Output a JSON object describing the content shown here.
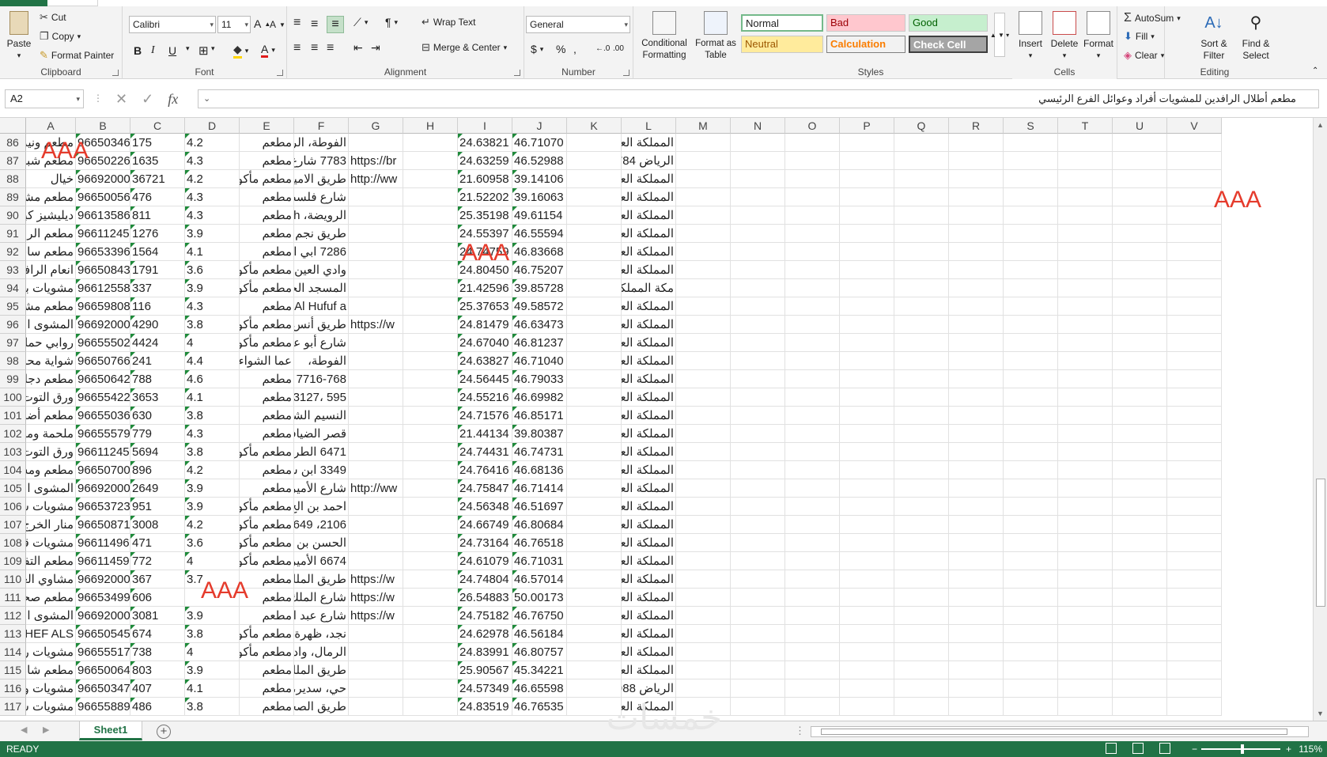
{
  "ribbon": {
    "clipboard": {
      "paste": "Paste",
      "cut": "Cut",
      "copy": "Copy",
      "format_painter": "Format Painter",
      "label": "Clipboard"
    },
    "font": {
      "name": "Calibri",
      "size": "11",
      "label": "Font",
      "bold": "B",
      "italic": "I",
      "underline": "U"
    },
    "alignment": {
      "wrap_text": "Wrap Text",
      "merge_center": "Merge & Center",
      "label": "Alignment"
    },
    "number": {
      "format": "General",
      "currency": "$",
      "percent": "%",
      "comma": ",",
      "label": "Number"
    },
    "styles": {
      "conditional": "Conditional Formatting",
      "format_table": "Format as Table",
      "normal": "Normal",
      "bad": "Bad",
      "good": "Good",
      "neutral": "Neutral",
      "calculation": "Calculation",
      "check_cell": "Check Cell",
      "label": "Styles"
    },
    "cells": {
      "insert": "Insert",
      "delete": "Delete",
      "format": "Format",
      "label": "Cells"
    },
    "editing": {
      "autosum": "AutoSum",
      "fill": "Fill",
      "clear": "Clear",
      "sort_filter": "Sort & Filter",
      "find_select": "Find & Select",
      "label": "Editing"
    }
  },
  "formula_bar": {
    "name_box": "A2",
    "content": "مطعم أطلال الرافدين للمشويات أفراد وعوائل الفرع الرئيسي",
    "fx": "fx"
  },
  "columns": [
    "A",
    "B",
    "C",
    "D",
    "E",
    "F",
    "G",
    "H",
    "I",
    "J",
    "K",
    "L",
    "M",
    "N",
    "O",
    "P",
    "Q",
    "R",
    "S",
    "T",
    "U",
    "V"
  ],
  "rows": [
    {
      "n": "86",
      "A": "مطعم ونيرة",
      "B": "96650346",
      "C": "175",
      "D": "4.2",
      "E": "مطعم",
      "F": "الفوطة، الريا",
      "G": "",
      "I": "24.63821",
      "J": "46.71070",
      "L": "المملكة العرب"
    },
    {
      "n": "87",
      "A": "مطعم شبك",
      "B": "96650226",
      "C": "1635",
      "D": "4.3",
      "E": "مطعم",
      "F": "7783 شارع",
      "G": "https://br",
      "I": "24.63259",
      "J": "46.52988",
      "L": "الرياض 784"
    },
    {
      "n": "88",
      "A": "خيال",
      "B": "96692000",
      "C": "36721",
      "D": "4.2",
      "E": "مطعم مأكولا",
      "F": "طريق الامير ،",
      "G": "http://ww",
      "I": "21.60958",
      "J": "39.14106",
      "L": "المملكة العرب"
    },
    {
      "n": "89",
      "A": "مطعم مشو",
      "B": "96650056",
      "C": "476",
      "D": "4.3",
      "E": "مطعم",
      "F": "شارع فلسطي",
      "G": "",
      "I": "21.52202",
      "J": "39.16063",
      "L": "المملكة العرب"
    },
    {
      "n": "90",
      "A": "ديليشيز كباب",
      "B": "96613586",
      "C": "811",
      "D": "4.3",
      "E": "مطعم",
      "F": "الرويضة، ah",
      "G": "",
      "I": "25.35198",
      "J": "49.61154",
      "L": "المملكة العرب"
    },
    {
      "n": "91",
      "A": "مطعم الرافد",
      "B": "96611245",
      "C": "1276",
      "D": "3.9",
      "E": "مطعم",
      "F": "طريق نجم ال",
      "G": "",
      "I": "24.55397",
      "J": "46.55594",
      "L": "المملكة العرب"
    },
    {
      "n": "92",
      "A": "مطعم ساحه",
      "B": "96653396",
      "C": "1564",
      "D": "4.1",
      "E": "مطعم",
      "F": "7286 ابي الا",
      "G": "",
      "I": "24.74759",
      "J": "46.83668",
      "L": "المملكة العرب"
    },
    {
      "n": "93",
      "A": "انعام الرافدي",
      "B": "96650843",
      "C": "1791",
      "D": "3.6",
      "E": "مطعم مأكولا",
      "F": "وادي العين،",
      "G": "",
      "I": "24.80450",
      "J": "46.75207",
      "L": "المملكة العرب"
    },
    {
      "n": "94",
      "A": "مشويات بلو",
      "B": "96612558",
      "C": "337",
      "D": "3.9",
      "E": "مطعم مأكولا",
      "F": "المسجد الحر",
      "G": "",
      "I": "21.42596",
      "J": "39.85728",
      "L": "مكة المملكة"
    },
    {
      "n": "95",
      "A": "مطعم مشو",
      "B": "96659808",
      "C": "116",
      "D": "4.3",
      "E": "مطعم",
      "F": "Al Hufuf a",
      "G": "",
      "I": "25.37653",
      "J": "49.58572",
      "L": "المملكة العرب"
    },
    {
      "n": "96",
      "A": "المشوى العر",
      "B": "96692000",
      "C": "4290",
      "D": "3.8",
      "E": "مطعم مأكولا",
      "F": "طريق أنس ابن",
      "G": "https://w",
      "I": "24.81479",
      "J": "46.63473",
      "L": "المملكة العرب"
    },
    {
      "n": "97",
      "A": "روابي حماة",
      "B": "96655502",
      "C": "4424",
      "D": "4",
      "E": "مطعم مأكولا",
      "F": "شارع أبو عبيد",
      "G": "",
      "I": "24.67040",
      "J": "46.81237",
      "L": "المملكة العرب"
    },
    {
      "n": "98",
      "A": "شواية محمد",
      "B": "96650766",
      "C": "241",
      "D": "4.4",
      "E": "عما الشواء",
      "F": "الفوطة،",
      "G": "",
      "I": "24.63827",
      "J": "46.71040",
      "L": "المملكة العرب"
    },
    {
      "n": "99",
      "A": "مطعم دجلة",
      "B": "96650642",
      "C": "788",
      "D": "4.6",
      "E": "مطعم",
      "F": "7716-768",
      "G": "",
      "I": "24.56445",
      "J": "46.79033",
      "L": "المملكة العرب"
    },
    {
      "n": "100",
      "A": "ورق التوت",
      "B": "96655422",
      "C": "3653",
      "D": "4.1",
      "E": "مطعم",
      "F": "595 ،3127",
      "G": "",
      "I": "24.55216",
      "J": "46.69982",
      "L": "المملكة العرب"
    },
    {
      "n": "101",
      "A": "مطعم أضنا",
      "B": "96655036",
      "C": "630",
      "D": "3.8",
      "E": "مطعم",
      "F": "النسيم الشرق",
      "G": "",
      "I": "24.71576",
      "J": "46.85171",
      "L": "المملكة العرب"
    },
    {
      "n": "102",
      "A": "ملحمة ومشو",
      "B": "96655579",
      "C": "779",
      "D": "4.3",
      "E": "مطعم",
      "F": "قصر الضيافة",
      "G": "",
      "I": "21.44134",
      "J": "39.80387",
      "L": "المملكة العرب"
    },
    {
      "n": "103",
      "A": "ورق التوت",
      "B": "96611245",
      "C": "5694",
      "D": "3.8",
      "E": "مطعم مأكولا",
      "F": "6471 الطري",
      "G": "",
      "I": "24.74431",
      "J": "46.74731",
      "L": "المملكة العرب"
    },
    {
      "n": "104",
      "A": "مطعم ومش",
      "B": "96650700",
      "C": "896",
      "D": "4.2",
      "E": "مطعم",
      "F": "3349 ابن س",
      "G": "",
      "I": "24.76416",
      "J": "46.68136",
      "L": "المملكة العرب"
    },
    {
      "n": "105",
      "A": "المشوى العر",
      "B": "96692000",
      "C": "2649",
      "D": "3.9",
      "E": "مطعم",
      "F": "شارع الأمير ،",
      "G": "http://ww",
      "I": "24.75847",
      "J": "46.71414",
      "L": "المملكة العرب"
    },
    {
      "n": "106",
      "A": "مشويات سا",
      "B": "96653723",
      "C": "951",
      "D": "3.9",
      "E": "مطعم مأكولا",
      "F": "احمد بن الخ",
      "G": "",
      "I": "24.56348",
      "J": "46.51697",
      "L": "المملكة العرب"
    },
    {
      "n": "107",
      "A": "منار الخرج ا",
      "B": "96650871",
      "C": "3008",
      "D": "4.2",
      "E": "مطعم مأكولا",
      "F": "2106، 649",
      "G": "",
      "I": "24.66749",
      "J": "46.80684",
      "L": "المملكة العرب"
    },
    {
      "n": "108",
      "A": "مشويات قص",
      "B": "96611496",
      "C": "471",
      "D": "3.6",
      "E": "مطعم مأكولا",
      "F": "الحسن بن ع",
      "G": "",
      "I": "24.73164",
      "J": "46.76518",
      "L": "المملكة العرب"
    },
    {
      "n": "109",
      "A": "مطعم التفا",
      "B": "96611459",
      "C": "772",
      "D": "4",
      "E": "مطعم مأكولا",
      "F": "6674 الأمير",
      "G": "",
      "I": "24.61079",
      "J": "46.71031",
      "L": "المملكة العرب"
    },
    {
      "n": "110",
      "A": "مشاوي العنا",
      "B": "96692000",
      "C": "367",
      "D": "3.7",
      "E": "مطعم",
      "F": "طريق الملك",
      "G": "https://w",
      "I": "24.74804",
      "J": "46.57014",
      "L": "المملكة العرب"
    },
    {
      "n": "111",
      "A": "مطعم صحا",
      "B": "96653499",
      "C": "606",
      "D": "",
      "E": "مطعم",
      "F": "شارع الملك",
      "G": "https://w",
      "I": "26.54883",
      "J": "50.00173",
      "L": "المملكة العرب"
    },
    {
      "n": "112",
      "A": "المشوى العر",
      "B": "96692000",
      "C": "3081",
      "D": "3.9",
      "E": "مطعم",
      "F": "شارع عبد الر",
      "G": "https://w",
      "I": "24.75182",
      "J": "46.76750",
      "L": "المملكة العرب"
    },
    {
      "n": "113",
      "A": "CHEF ALS",
      "B": "96650545",
      "C": "674",
      "D": "3.8",
      "E": "مطعم مأكولا",
      "F": "نجد، ظهرة ل",
      "G": "",
      "I": "24.62978",
      "J": "46.56184",
      "L": "المملكة العرب"
    },
    {
      "n": "114",
      "A": "مشويات رما",
      "B": "96655517",
      "C": "738",
      "D": "4",
      "E": "مطعم مأكولا",
      "F": "الرمال، وادي",
      "G": "",
      "I": "24.83991",
      "J": "46.80757",
      "L": "المملكة العرب"
    },
    {
      "n": "115",
      "A": "مطعم شام",
      "B": "96650064",
      "C": "803",
      "D": "3.9",
      "E": "مطعم",
      "F": "طريق الملك",
      "G": "",
      "I": "25.90567",
      "J": "45.34221",
      "L": "المملكة العرب"
    },
    {
      "n": "116",
      "A": "مشويات ولي",
      "B": "96650347",
      "C": "407",
      "D": "4.1",
      "E": "مطعم",
      "F": "حي، سدير، ،",
      "G": "",
      "I": "24.57349",
      "J": "46.65598",
      "L": "الرياض 988"
    },
    {
      "n": "117",
      "A": "مشويات شا",
      "B": "96655889",
      "C": "486",
      "D": "3.8",
      "E": "مطعم",
      "F": "طريق الصحا",
      "G": "",
      "I": "24.83519",
      "J": "46.76535",
      "L": "المملكة العرب"
    }
  ],
  "overlays": {
    "text": "AAA"
  },
  "sheets": {
    "active": "Sheet1"
  },
  "status": {
    "ready": "READY",
    "zoom": "115%"
  },
  "watermark": "خمسات",
  "colors": {
    "excel_green": "#217346",
    "overlay_red": "#e53b2c"
  }
}
